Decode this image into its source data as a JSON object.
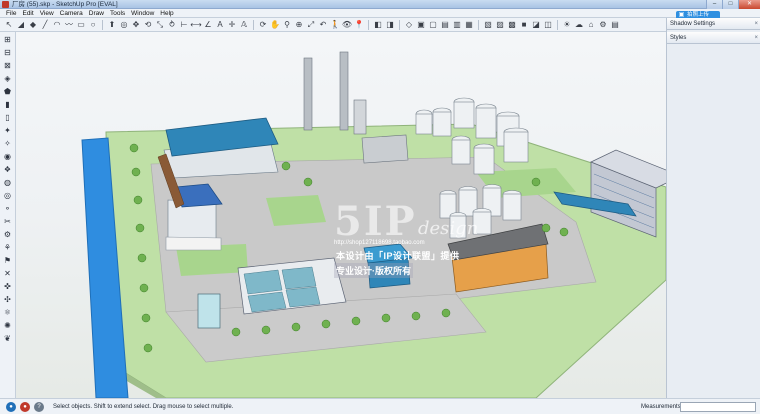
{
  "window": {
    "title": "厂房 (55).skp - SketchUp Pro [EVAL]",
    "minimize": "–",
    "maximize": "□",
    "close": "✕"
  },
  "menu": [
    "File",
    "Edit",
    "View",
    "Camera",
    "Draw",
    "Tools",
    "Window",
    "Help"
  ],
  "toolbar_icons": [
    "select-icon",
    "eraser-icon",
    "paint-bucket-icon",
    "line-icon",
    "arc-icon",
    "freehand-icon",
    "rectangle-icon",
    "circle-icon",
    "push-pull-icon",
    "offset-icon",
    "move-icon",
    "rotate-icon",
    "scale-icon",
    "follow-me-icon",
    "tape-icon",
    "dimension-icon",
    "protractor-icon",
    "text-icon",
    "axes-icon",
    "3d-text-icon",
    "orbit-icon",
    "pan-icon",
    "zoom-icon",
    "zoom-window-icon",
    "zoom-extents-icon",
    "previous-view-icon",
    "walk-icon",
    "look-around-icon",
    "position-camera-icon",
    "section-plane-icon",
    "display-section-icon",
    "iso-view-icon",
    "top-view-icon",
    "front-view-icon",
    "right-view-icon",
    "back-view-icon",
    "left-view-icon",
    "xray-icon",
    "wireframe-icon",
    "hidden-line-icon",
    "shaded-icon",
    "textured-icon",
    "monochrome-icon",
    "shadow-icon",
    "fog-icon",
    "warehouse-icon",
    "extension-icon",
    "layout-icon"
  ],
  "toolbar_glyphs": [
    "↖",
    "◢",
    "◆",
    "╱",
    "◠",
    "〰",
    "▭",
    "○",
    "⬆",
    "◎",
    "✥",
    "⟲",
    "⤡",
    "⥁",
    "⊢",
    "⟷",
    "∠",
    "A",
    "✛",
    "𝔸",
    "⟳",
    "✋",
    "⚲",
    "⊕",
    "⤢",
    "↶",
    "🚶",
    "👁",
    "📍",
    "◧",
    "◨",
    "◇",
    "▣",
    "▢",
    "▤",
    "▥",
    "▦",
    "▧",
    "▨",
    "▩",
    "■",
    "◪",
    "◫",
    "☀",
    "☁",
    "⌂",
    "⚙",
    "▤"
  ],
  "left_palette_glyphs": [
    "⊞",
    "⊟",
    "⊠",
    "◈",
    "⬟",
    "▮",
    "▯",
    "✦",
    "✧",
    "◉",
    "❖",
    "◍",
    "◎",
    "⚬",
    "✂",
    "⚙",
    "⚘",
    "⚑",
    "✕",
    "✜",
    "✣",
    "⚛",
    "✺",
    "❦"
  ],
  "tray": {
    "panels": [
      "Shadow Settings",
      "Styles"
    ],
    "close_glyph": "×",
    "floating_button": "拍照上传"
  },
  "status": {
    "text": "Select objects. Shift to extend select. Drag mouse to select multiple.",
    "measurements_label": "Measurements",
    "measurements_value": ""
  },
  "watermark": {
    "logo": "5IP",
    "logo_sub": "design",
    "url": "http://shop127118698.taobao.com",
    "line1": "本设计由「IP设计联盟」提供",
    "line2": "专业设计·版权所有"
  },
  "colors": {
    "ground": "#bfe0a6",
    "canal": "#2f8de0",
    "roof_blue": "#2f86b8",
    "road": "#c7c7c7"
  }
}
